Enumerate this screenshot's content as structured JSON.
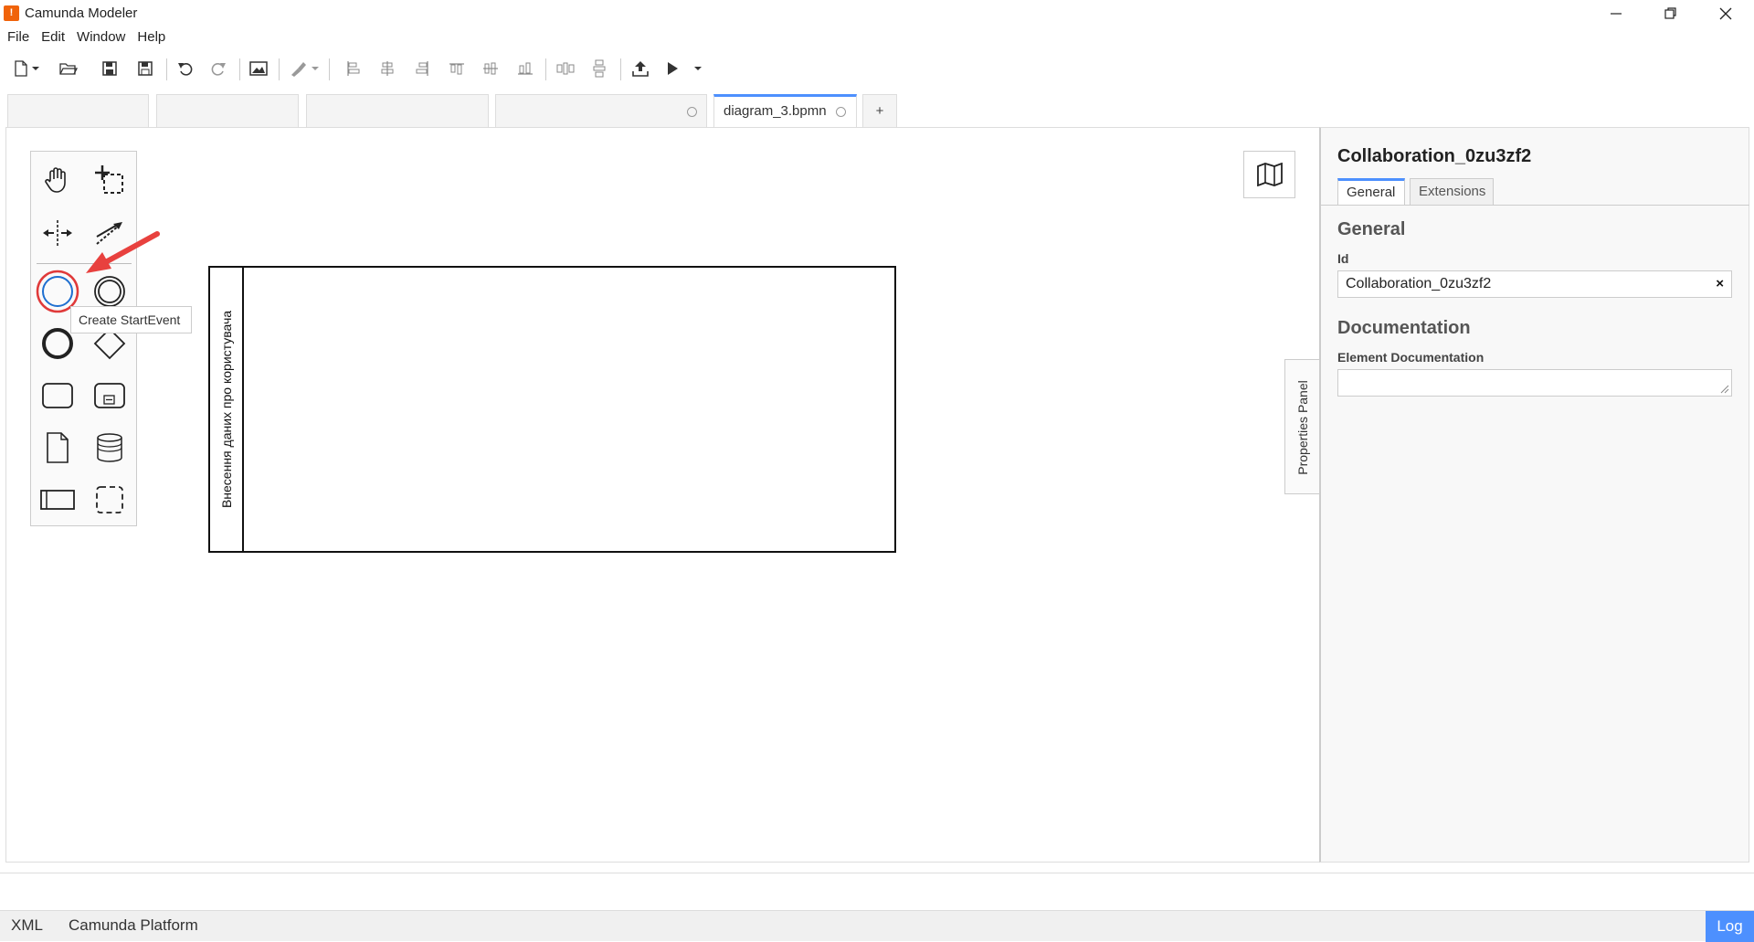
{
  "window": {
    "title": "Camunda Modeler",
    "app_icon_glyph": "!"
  },
  "menu": [
    "File",
    "Edit",
    "Window",
    "Help"
  ],
  "tabs": {
    "blurred": [
      "",
      "",
      "",
      ""
    ],
    "active": "diagram_3.bpmn",
    "add": "+"
  },
  "tooltip": "Create StartEvent",
  "pool": {
    "label": "Внесення даних про користувача"
  },
  "properties_toggle": "Properties Panel",
  "properties": {
    "title": "Collaboration_0zu3zf2",
    "tabs": [
      "General",
      "Extensions"
    ],
    "general_heading": "General",
    "id_label": "Id",
    "id_value": "Collaboration_0zu3zf2",
    "id_clear": "×",
    "documentation_heading": "Documentation",
    "element_doc_label": "Element Documentation",
    "element_doc_value": ""
  },
  "statusbar": {
    "xml": "XML",
    "platform": "Camunda Platform",
    "log": "Log"
  },
  "colors": {
    "accent": "#4d90fe",
    "highlight_ring": "#e03a3a",
    "annotation_arrow": "#e8413e",
    "app_icon": "#f0630a"
  }
}
